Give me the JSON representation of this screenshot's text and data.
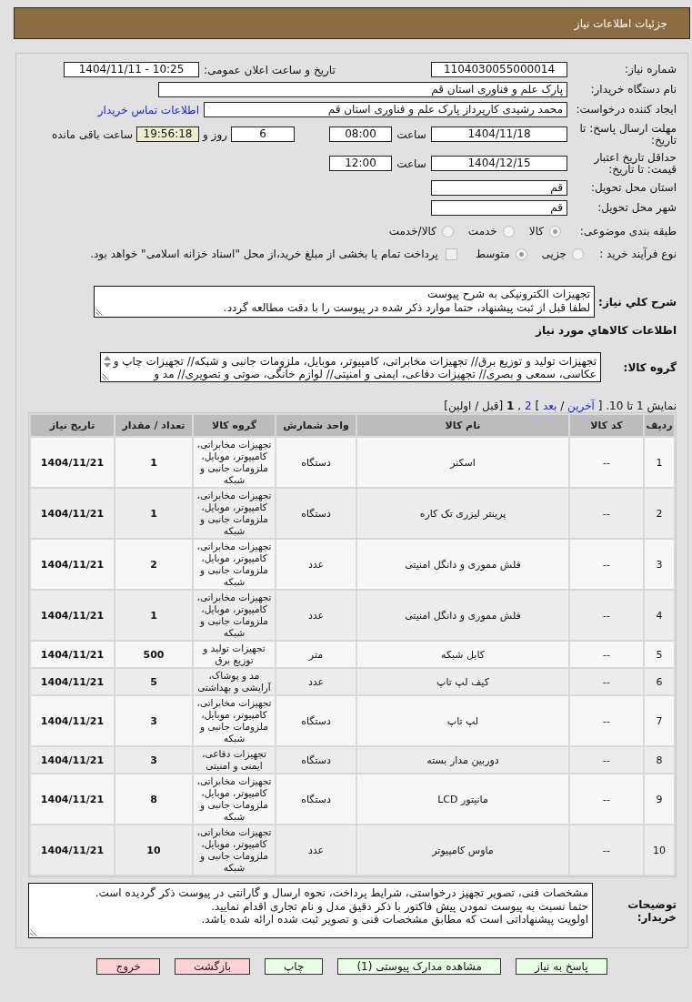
{
  "header": {
    "title": "جزئیات اطلاعات نیاز"
  },
  "details": {
    "need_number": {
      "label": "شماره نیاز:",
      "value": "1104030055000014"
    },
    "announcement": {
      "label": "تاریخ و ساعت اعلان عمومی:",
      "value": "1404/11/11 - 10:25"
    },
    "buyer_org": {
      "label": "نام دستگاه خریدار:",
      "value": "پارک علم و فناوری استان قم"
    },
    "requester": {
      "label": "ایجاد کننده درخواست:",
      "value": "محمد رشیدی کارپرداز پارک علم و فناوری استان قم",
      "contact_link": "اطلاعات تماس خریدار"
    },
    "reply_deadline": {
      "label": "مهلت ارسال پاسخ: تا تاریخ:",
      "date": "1404/11/18",
      "time_label": "ساعت",
      "time": "08:00",
      "days": "6",
      "days_label": "روز و",
      "remaining": "19:56:18",
      "remaining_label": "ساعت باقی مانده"
    },
    "price_validity": {
      "label": "حداقل تاریخ اعتبار قیمت: تا تاریخ:",
      "date": "1404/12/15",
      "time_label": "ساعت",
      "time": "12:00"
    },
    "delivery_province": {
      "label": "استان محل تحویل:",
      "value": "قم"
    },
    "delivery_city": {
      "label": "شهر محل تحویل:",
      "value": "قم"
    },
    "subject_category": {
      "label": "طبقه بندی موضوعی:",
      "disabled": true,
      "options": [
        {
          "label": "کالا",
          "selected": true
        },
        {
          "label": "خدمت",
          "selected": false
        },
        {
          "label": "کالا/خدمت",
          "selected": false
        }
      ]
    },
    "purchase_process": {
      "label": "نوع فرآیند خرید :",
      "disabled": true,
      "options": [
        {
          "label": "جزیی",
          "selected": false
        },
        {
          "label": "متوسط",
          "selected": true
        }
      ],
      "treasury_option": {
        "label": "پرداخت تمام یا بخشی از مبلغ خرید،از محل \"اسناد خزانه اسلامی\" خواهد بود.",
        "checked": false,
        "disabled": true
      }
    },
    "summary": {
      "label": "شرح كلي نياز:",
      "lines": [
        "تجهیزات الکترونیکی به شرح پیوست",
        "لطفا قبل از ثبت پیشنهاد، حتما موارد ذکر شده در پیوست را با دقت مطالعه گردد."
      ]
    }
  },
  "goods": {
    "heading": "اطلاعات کالاهاي مورد نياز",
    "group": {
      "label": "گروه کالا:",
      "text": "تجهیزات تولید و توزیع برق// تجهیزات مخابراتی، کامپیوتر، موبایل، ملزومات جانبی و شبکه// تجهیزات چاپ و عکاسی، سمعی و بصری// تجهیزات دفاعی، ایمنی و امنیتی// لوازم خانگی، صوتی و تصویری// مد و"
    },
    "pager": {
      "summary": "نمایش 1 تا 10.",
      "items": [
        {
          "kind": "text",
          "text": "["
        },
        {
          "kind": "link",
          "text": "آخرین"
        },
        {
          "kind": "text",
          "text": "/"
        },
        {
          "kind": "link",
          "text": "بعد"
        },
        {
          "kind": "text",
          "text": "]"
        },
        {
          "kind": "link",
          "text": "2"
        },
        {
          "kind": "text",
          "text": ","
        },
        {
          "kind": "current",
          "text": "1"
        },
        {
          "kind": "text",
          "text": "[قبل / اولین]"
        }
      ]
    },
    "table": {
      "columns": [
        "ردیف",
        "کد کالا",
        "نام کالا",
        "واحد شمارش",
        "گروه کالا",
        "تعداد / مقدار",
        "تاریخ نیاز"
      ],
      "rows": [
        [
          "1",
          "--",
          "اسکنر",
          "دستگاه",
          "تجهیزات مخابراتی، کامپیوتر، موبایل، ملزومات جانبی و شبکه",
          "1",
          "1404/11/21"
        ],
        [
          "2",
          "--",
          "پرینتر لیزری تک کاره",
          "دستگاه",
          "تجهیزات مخابراتی، کامپیوتر، موبایل، ملزومات جانبی و شبکه",
          "1",
          "1404/11/21"
        ],
        [
          "3",
          "--",
          "فلش مموری و دانگل امنیتی",
          "عدد",
          "تجهیزات مخابراتی، کامپیوتر، موبایل، ملزومات جانبی و شبکه",
          "2",
          "1404/11/21"
        ],
        [
          "4",
          "--",
          "فلش مموری و دانگل امنیتی",
          "عدد",
          "تجهیزات مخابراتی، کامپیوتر، موبایل، ملزومات جانبی و شبکه",
          "1",
          "1404/11/21"
        ],
        [
          "5",
          "--",
          "کابل شبکه",
          "متر",
          "تجهیزات تولید و توزیع برق",
          "500",
          "1404/11/21"
        ],
        [
          "6",
          "--",
          "کیف لپ تاپ",
          "عدد",
          "مد و پوشاک، آرایشی و بهداشتی",
          "5",
          "1404/11/21"
        ],
        [
          "7",
          "--",
          "لپ تاپ",
          "دستگاه",
          "تجهیزات مخابراتی، کامپیوتر، موبایل، ملزومات جانبی و شبکه",
          "3",
          "1404/11/21"
        ],
        [
          "8",
          "--",
          "دوربین مدار بسته",
          "دستگاه",
          "تجهیزات دفاعی، ایمنی و امنیتی",
          "3",
          "1404/11/21"
        ],
        [
          "9",
          "--",
          "مانیتور LCD",
          "دستگاه",
          "تجهیزات مخابراتی، کامپیوتر، موبایل، ملزومات جانبی و شبکه",
          "8",
          "1404/11/21"
        ],
        [
          "10",
          "--",
          "ماوس کامپیوتر",
          "عدد",
          "تجهیزات مخابراتی، کامپیوتر، موبایل، ملزومات جانبی و شبکه",
          "10",
          "1404/11/21"
        ]
      ]
    }
  },
  "buyer_notes": {
    "label": "توضیحات خریدار:",
    "lines": [
      "مشخصات فنی، تصویر تجهیز درخواستی، شرایط پرداخت، نحوه ارسال و گارانتی در پیوست ذکر گردیده است.",
      "حتما نسبت به پیوست نمودن پیش فاکتور با ذکر دقیق مدل و نام تجاری اقدام نمایید.",
      "اولویت پیشنهاداتی است که مطابق مشخصات فنی و تصویر ثبت شده ارائه شده باشد."
    ]
  },
  "buttons": [
    {
      "label": "پاسخ به نیاز",
      "kind": "action"
    },
    {
      "label": "مشاهده مدارک پیوستی (1)",
      "kind": "action"
    },
    {
      "label": "چاپ",
      "kind": "action"
    },
    {
      "label": "بازگشت",
      "kind": "exit"
    },
    {
      "label": "خروج",
      "kind": "exit"
    }
  ]
}
